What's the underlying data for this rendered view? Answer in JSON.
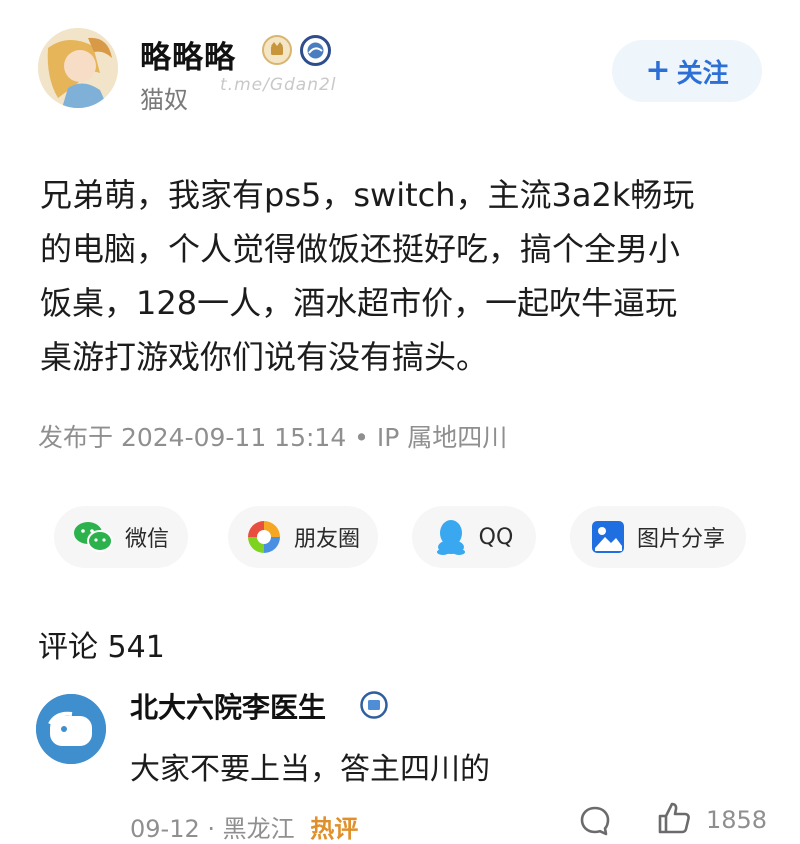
{
  "post": {
    "author": {
      "name": "略略略",
      "subtitle": "猫奴",
      "watermark": "t.me/Gdan2l"
    },
    "follow_label": "关注",
    "follow_plus": "+",
    "lines": [
      "兄弟萌，我家有ps5，switch，主流3a2k畅玩",
      "的电脑，个人觉得做饭还挺好吃，搞个全男小",
      "饭桌，128一人，酒水超市价，一起吹牛逼玩",
      "桌游打游戏你们说有没有搞头。"
    ],
    "meta": "发布于 2024-09-11 15:14 • IP 属地四川"
  },
  "share": {
    "wechat": "微信",
    "moments": "朋友圈",
    "qq": "QQ",
    "image": "图片分享"
  },
  "comments": {
    "title": "评论 541",
    "items": [
      {
        "name": "北大六院李医生",
        "text": "大家不要上当，答主四川的",
        "date": "09-12",
        "location": "· 黑龙江",
        "tag": "热评",
        "likes": "1858"
      }
    ]
  },
  "colors": {
    "accent": "#2c6fd6",
    "hot": "#e0902a",
    "muted": "#8f8f8f"
  }
}
